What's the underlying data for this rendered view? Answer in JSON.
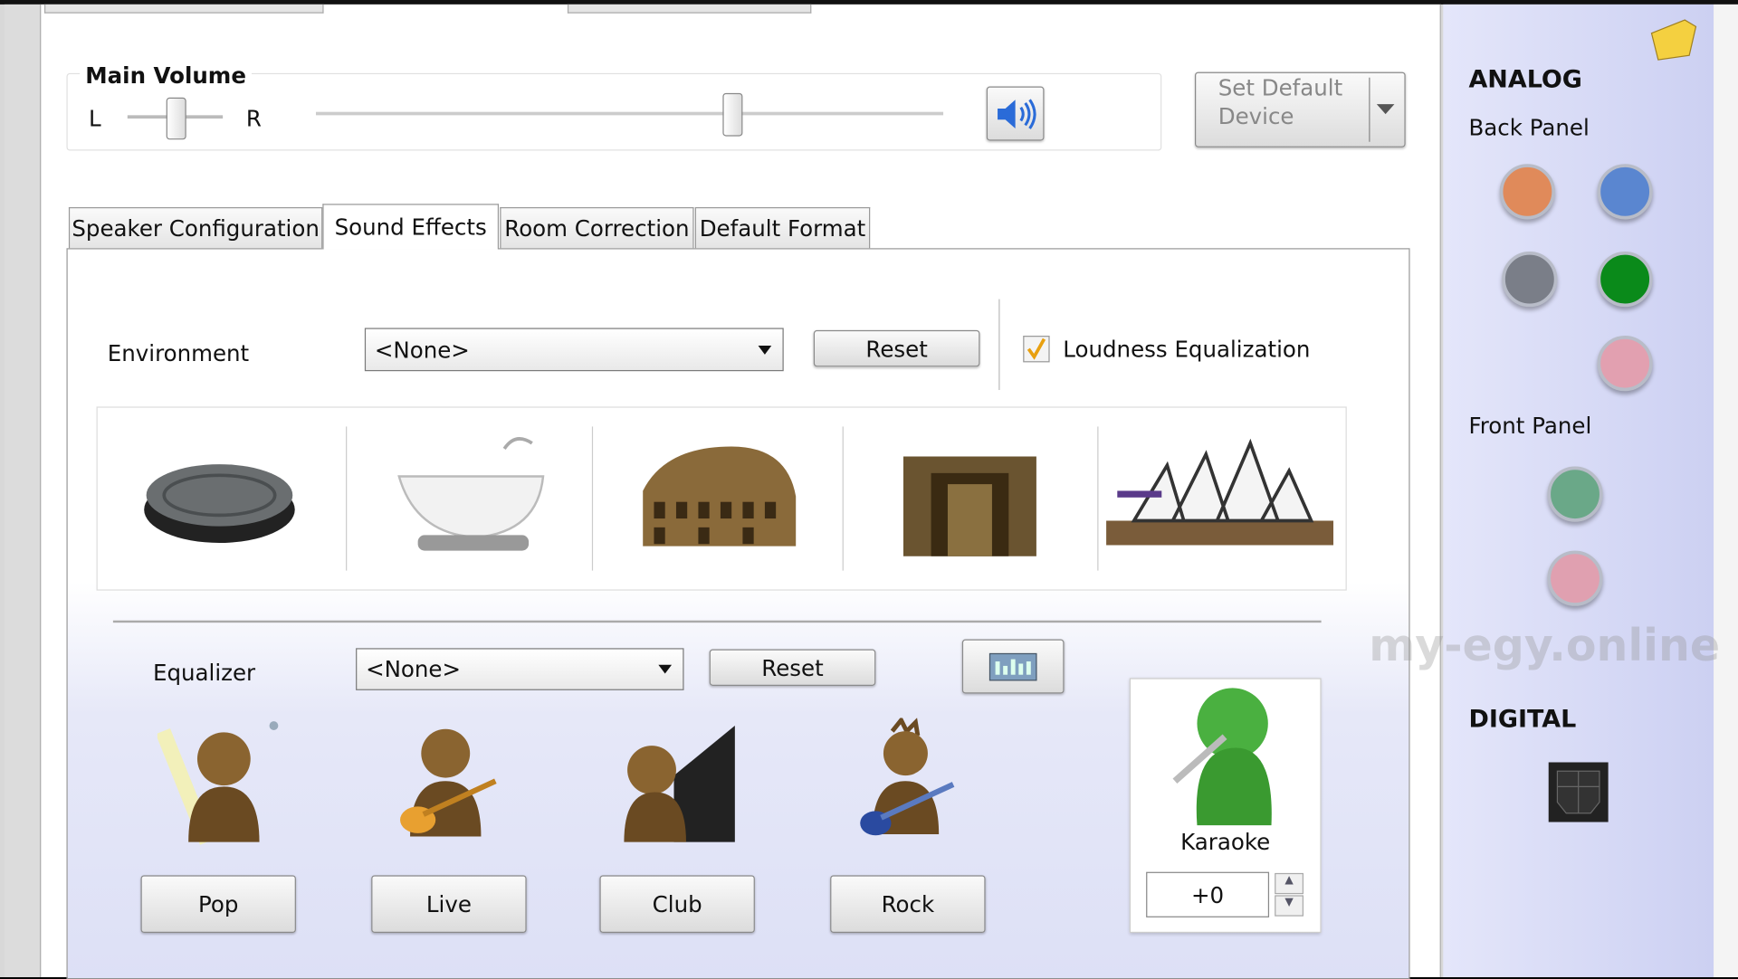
{
  "main_volume": {
    "label": "Main Volume",
    "balance_left": "L",
    "balance_right": "R",
    "balance_position": 0.5,
    "volume_level": 0.66
  },
  "set_default": {
    "label_line1": "Set Default",
    "label_line2": "Device"
  },
  "tabs": [
    {
      "label": "Speaker Configuration"
    },
    {
      "label": "Sound Effects",
      "selected": true
    },
    {
      "label": "Room Correction"
    },
    {
      "label": "Default Format"
    }
  ],
  "environment": {
    "label": "Environment",
    "value": "<None>",
    "reset": "Reset",
    "loudness_label": "Loudness Equalization",
    "loudness_checked": true,
    "presets": [
      "stone-icon",
      "bathtub-icon",
      "colosseum-icon",
      "stone-room-icon",
      "opera-house-icon"
    ]
  },
  "equalizer": {
    "label": "Equalizer",
    "value": "<None>",
    "reset": "Reset",
    "presets": [
      {
        "label": "Pop"
      },
      {
        "label": "Live"
      },
      {
        "label": "Club"
      },
      {
        "label": "Rock"
      }
    ]
  },
  "karaoke": {
    "label": "Karaoke",
    "value": "+0"
  },
  "side": {
    "analog": "ANALOG",
    "back_panel": "Back Panel",
    "front_panel": "Front Panel",
    "digital": "DIGITAL",
    "back_jacks": [
      "#e08a5a",
      "#5a86d0",
      "#7a7e88",
      "#0a8a1a",
      "#e2a0b0"
    ],
    "front_jacks": [
      "#6aa888",
      "#e0a0b0"
    ]
  },
  "watermark": "my-egy.online"
}
